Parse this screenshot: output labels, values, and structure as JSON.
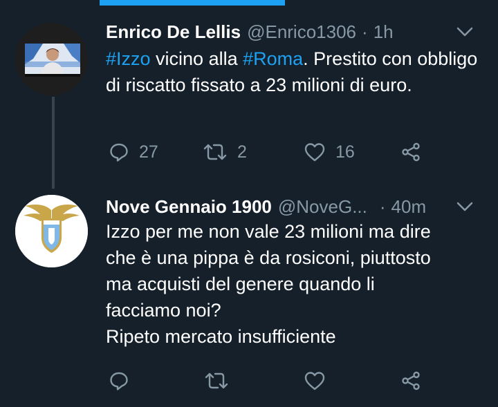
{
  "tweets": [
    {
      "name": "Enrico De Lellis",
      "handle": "@Enrico1306",
      "dot": "·",
      "time": "1h",
      "hashtag1": "#Izzo",
      "text1": " vicino alla ",
      "hashtag2": "#Roma",
      "text2": ". Prestito con obbligo di riscatto fissato a 23 milioni di euro.",
      "reply_count": "27",
      "retweet_count": "2",
      "like_count": "16"
    },
    {
      "name": "Nove Gennaio 1900",
      "handle": "@NoveG...",
      "dot": "·",
      "time": "40m",
      "line1": "Izzo per me non vale 23 milioni ma dire",
      "line2": "che è una pippa è da rosiconi, piuttosto",
      "line3": "ma acquisti del genere quando li",
      "line4": "facciamo noi?",
      "line5": "Ripeto mercato insufficiente"
    }
  ],
  "icons": {
    "reply": "reply-icon",
    "retweet": "retweet-icon",
    "like": "heart-icon",
    "share": "share-icon",
    "caret": "chevron-down-icon"
  },
  "colors": {
    "background": "#15202b",
    "text": "#ffffff",
    "muted": "#8899a6",
    "accent": "#1da1f2",
    "thread_line": "#38444d"
  }
}
